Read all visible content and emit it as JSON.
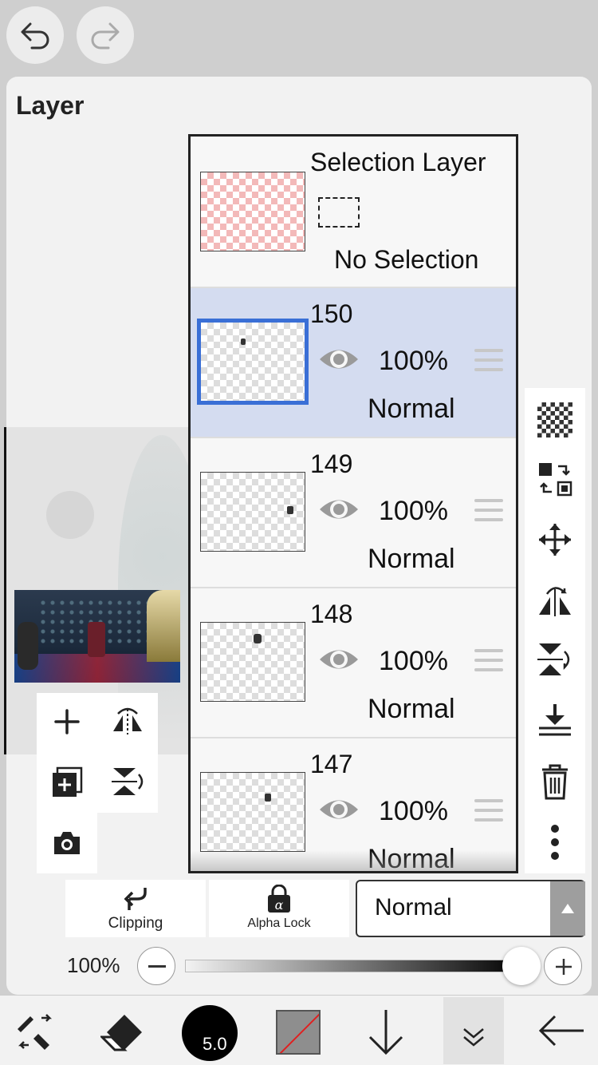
{
  "panel": {
    "title": "Layer"
  },
  "selection_layer": {
    "title": "Selection Layer",
    "status": "No Selection"
  },
  "layers": [
    {
      "number": "150",
      "opacity": "100%",
      "blend": "Normal",
      "selected": true
    },
    {
      "number": "149",
      "opacity": "100%",
      "blend": "Normal",
      "selected": false
    },
    {
      "number": "148",
      "opacity": "100%",
      "blend": "Normal",
      "selected": false
    },
    {
      "number": "147",
      "opacity": "100%",
      "blend": "Normal",
      "selected": false
    }
  ],
  "controls": {
    "clipping_label": "Clipping",
    "alpha_lock_label": "Alpha Lock",
    "blend_mode_value": "Normal",
    "opacity_value": "100%",
    "opacity_fraction": 1.0
  },
  "toolbar": {
    "brush_size": "5.0"
  },
  "colors": {
    "accent": "#3a6fd6",
    "selected_row": "#d4dcf0",
    "selection_checker": "#f3b9b9"
  }
}
